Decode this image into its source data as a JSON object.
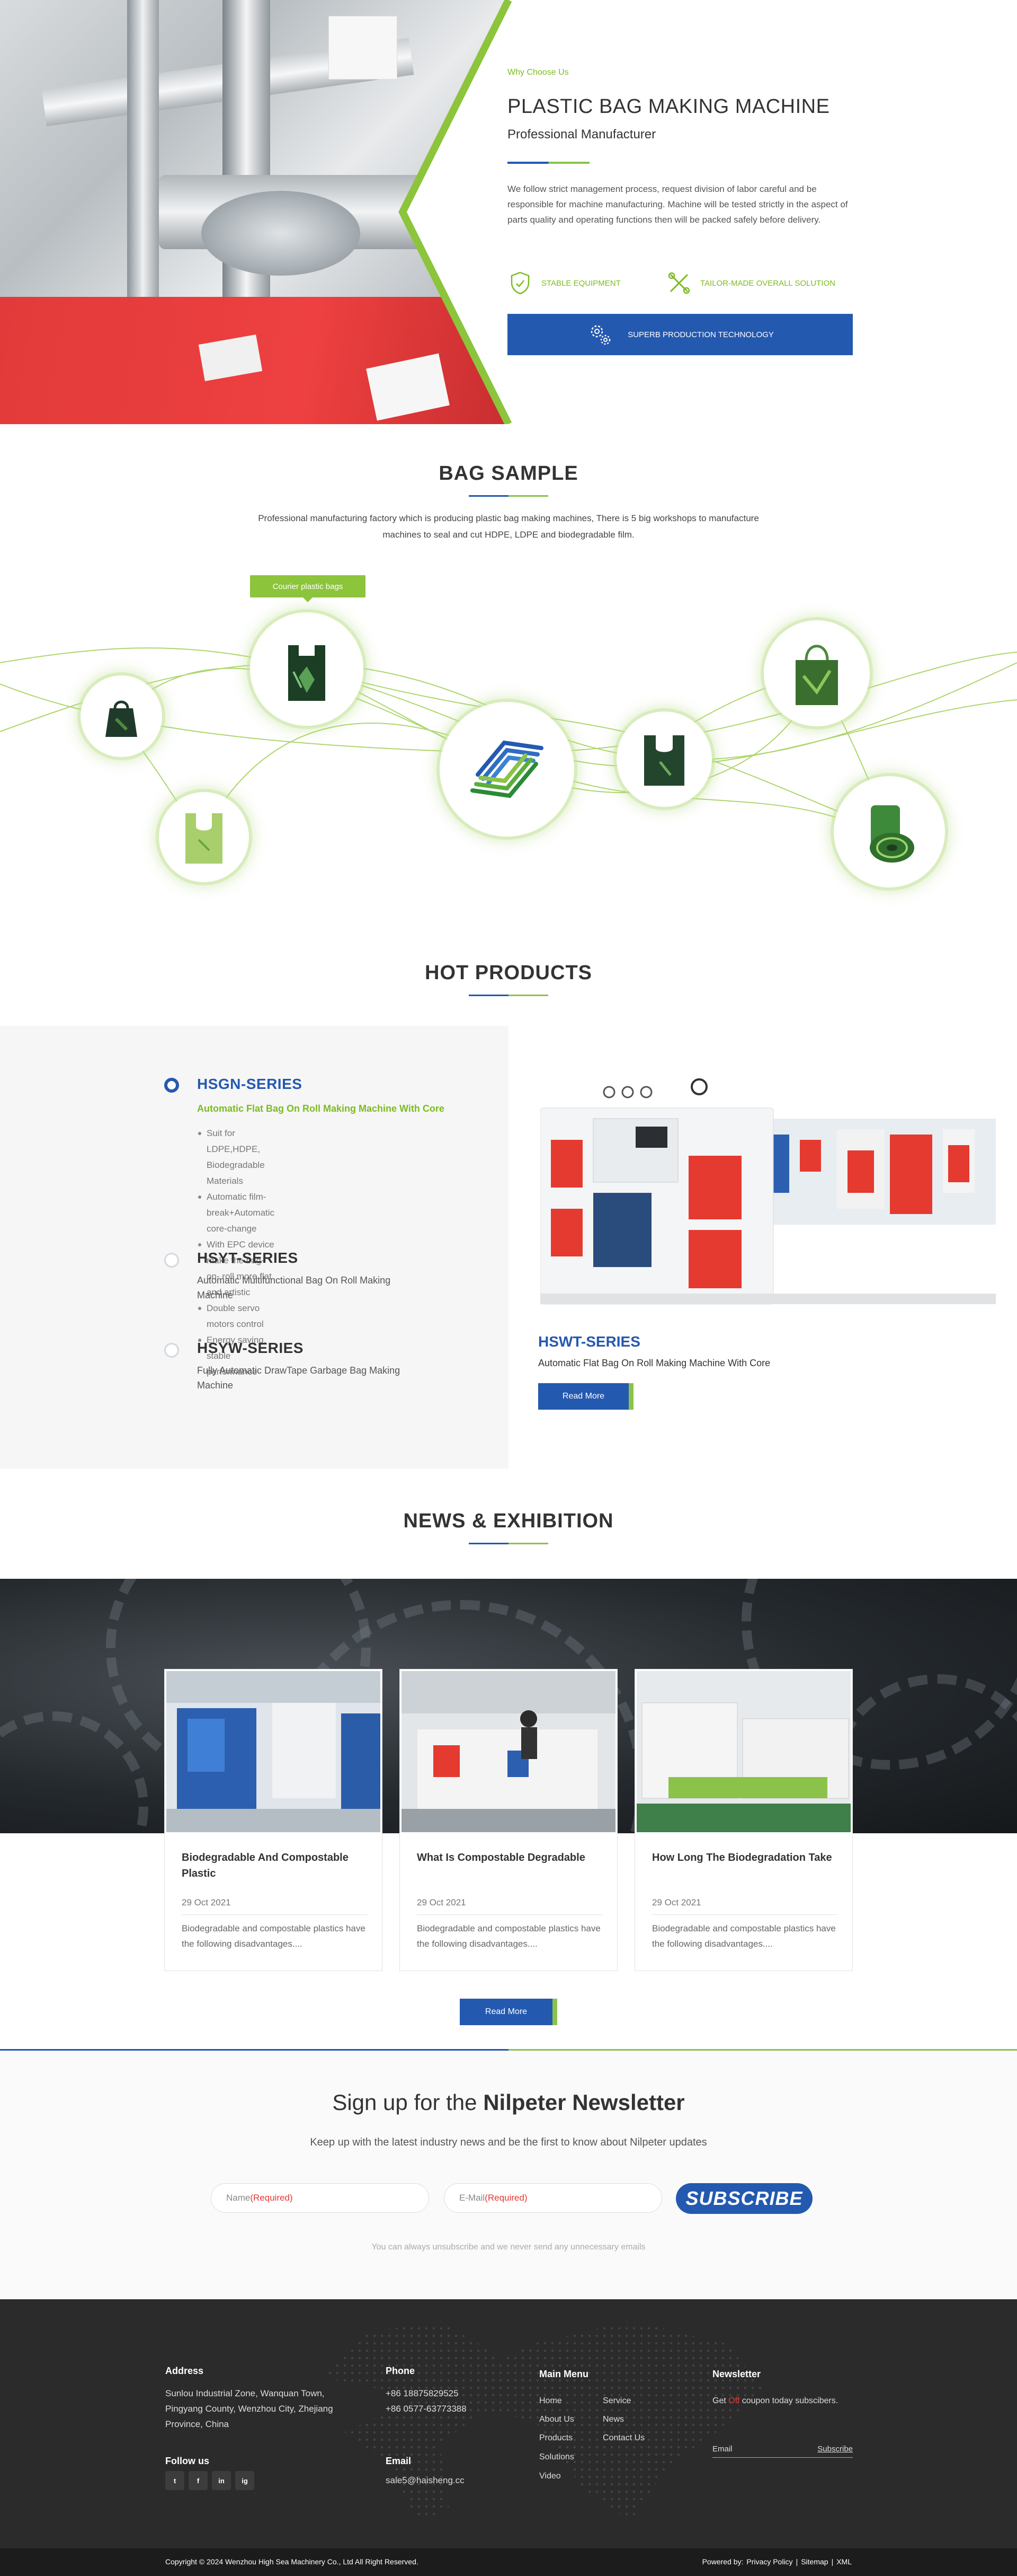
{
  "hero": {
    "eyebrow": "Why Choose Us",
    "title": "PLASTIC BAG MAKING MACHINE",
    "subtitle": "Professional Manufacturer",
    "paragraph": "We follow strict management process, request division of labor careful and be responsible for machine manufacturing. Machine will be tested strictly in the aspect of parts quality and operating functions then will be packed safely before delivery.",
    "features": [
      {
        "label": "STABLE EQUIPMENT",
        "icon": "shield-icon"
      },
      {
        "label": "TAILOR-MADE OVERALL SOLUTION",
        "icon": "tools-icon"
      }
    ],
    "highlight": {
      "label": "SUPERB PRODUCTION TECHNOLOGY",
      "icon": "gears-icon"
    },
    "colors": {
      "green": "#7cbb21",
      "blue": "#2459b0"
    }
  },
  "bag_sample": {
    "title": "BAG SAMPLE",
    "description": "Professional manufacturing factory which is producing plastic bag making machines, There is 5 big workshops to manufacture machines to seal and cut HDPE, LDPE and biodegradable film.",
    "tag": "Courier plastic bags"
  },
  "hot_products": {
    "title": "HOT PRODUCTS",
    "series": [
      {
        "name": "HSGN-SERIES",
        "subtitle": "Automatic Flat Bag On Roll Making Machine With Core",
        "bullets": [
          "Suit for LDPE,HDPE, Biodegradable Materials",
          "Automatic film-break+Automatic core-change",
          "With EPC device make the bag-on- roll more flat and artistic",
          "Double servo motors control",
          "Energy saving, stable performance"
        ],
        "active": true
      },
      {
        "name": "HSYT-SERIES",
        "subtitle": "Automatic Multifunctional Bag On Roll Making Machine",
        "active": false
      },
      {
        "name": "HSYW-SERIES",
        "subtitle": "Fully Automatic DrawTape Garbage Bag Making Machine",
        "active": false
      }
    ],
    "featured": {
      "name": "HSWT-SERIES",
      "subtitle": "Automatic Flat Bag On Roll Making Machine With Core",
      "button": "Read More"
    }
  },
  "news": {
    "title": "NEWS & EXHIBITION",
    "items": [
      {
        "title": "Biodegradable And Compostable Plastic",
        "date": "29 Oct 2021",
        "excerpt": "Biodegradable and compostable plastics have the following disadvantages...."
      },
      {
        "title": "What Is Compostable Degradable",
        "date": "29 Oct 2021",
        "excerpt": "Biodegradable and compostable plastics have the following disadvantages...."
      },
      {
        "title": "How Long The Biodegradation Take",
        "date": "29 Oct 2021",
        "excerpt": "Biodegradable and compostable plastics have the following disadvantages...."
      }
    ],
    "button": "Read More"
  },
  "newsletter": {
    "title_plain": "Sign up for the ",
    "title_bold": "Nilpeter Newsletter",
    "subtitle": "Keep up with the latest industry news and be the first to know about Nilpeter updates",
    "name_placeholder": "Name",
    "email_placeholder": "E-Mail",
    "required": "(Required)",
    "button": "SUBSCRIBE",
    "note": "You can always unsubscribe and we never send any unnecessary emails"
  },
  "footer": {
    "address_head": "Address",
    "address": "Sunlou Industrial Zone, Wanquan Town, Pingyang County, Wenzhou City, Zhejiang Province, China",
    "follow_head": "Follow us",
    "social": [
      "twitter-icon",
      "facebook-icon",
      "linkedin-icon",
      "instagram-icon"
    ],
    "social_glyphs": [
      "t",
      "f",
      "in",
      "ig"
    ],
    "phone_head": "Phone",
    "phones": [
      "+86 18875829525",
      "+86 0577-63773388"
    ],
    "email_head": "Email",
    "email": "sale5@haisheng.cc",
    "menu_head": "Main Menu",
    "menu_col1": [
      "Home",
      "About Us",
      "Products",
      "Solutions",
      "Video"
    ],
    "menu_col2": [
      "Service",
      "News",
      "Contact Us"
    ],
    "newsletter_head": "Newsletter",
    "newsletter_pre": "Get ",
    "newsletter_off": "Off",
    "newsletter_post": " coupon today subscibers.",
    "email_field": "Email",
    "subscribe": "Subscribe",
    "copyright": "Copyright © 2024 Wenzhou High Sea Machinery Co., Ltd All Right Reserved.",
    "powered_by": "Powered by:",
    "bottom_links": [
      "Privacy Policy",
      "Sitemap",
      "XML"
    ]
  }
}
